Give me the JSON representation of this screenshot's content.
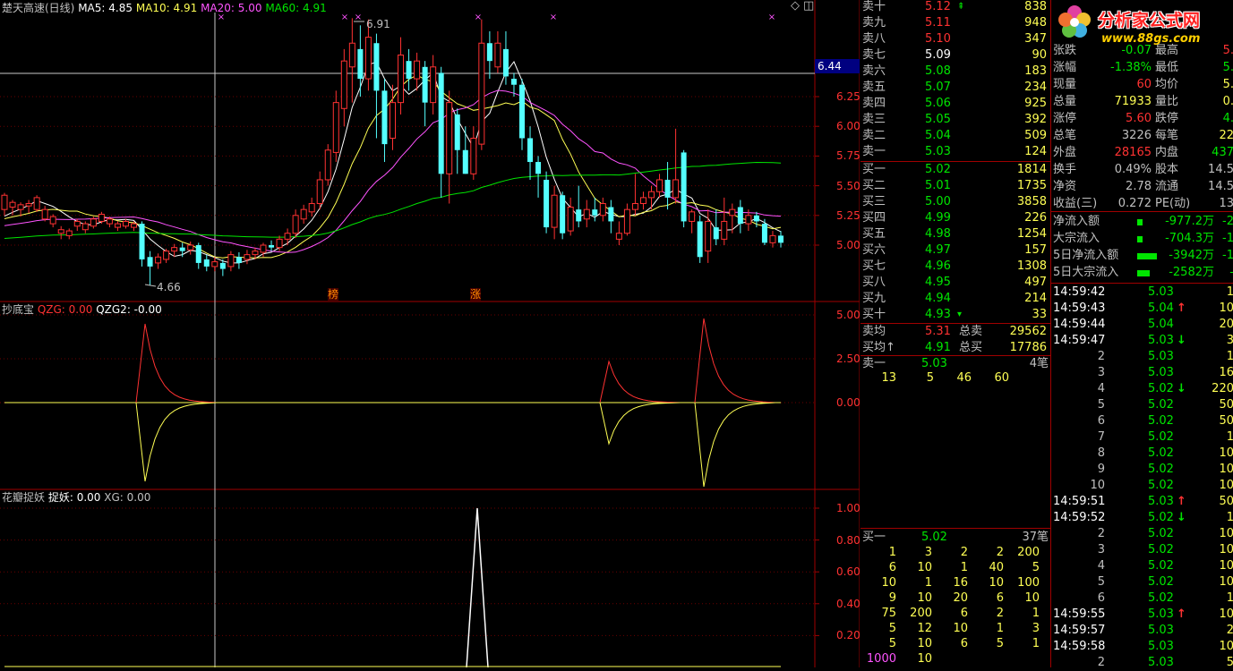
{
  "header": {
    "stock_name": "楚天高速(日线)",
    "ma5": "MA5: 4.85",
    "ma10": "MA10: 4.91",
    "ma20": "MA20: 5.00",
    "ma60": "MA60: 4.91",
    "high_label": "6.91",
    "low_label": "4.66",
    "cursor_price": "6.44",
    "mark_1": "榜",
    "mark_2": "涨"
  },
  "price_axis": [
    "6.25",
    "6.00",
    "5.75",
    "5.50",
    "5.25",
    "5.00"
  ],
  "indicator1": {
    "title": "抄底宝",
    "qzg": "QZG: 0.00",
    "qzg2": "QZG2: -0.00",
    "axis": [
      "5.00",
      "2.50",
      "0.00"
    ]
  },
  "indicator2": {
    "title": "花瓣捉妖",
    "zy": "捉妖: 0.00",
    "xg": "XG: 0.00",
    "axis": [
      "1.00",
      "0.80",
      "0.60",
      "0.40",
      "0.20"
    ]
  },
  "candles": [
    [
      5.3,
      5.42,
      5.25,
      5.44,
      0
    ],
    [
      5.32,
      5.36,
      5.25,
      5.38,
      0
    ],
    [
      5.3,
      5.34,
      5.24,
      5.36,
      0
    ],
    [
      5.33,
      5.35,
      5.27,
      5.38,
      0
    ],
    [
      5.3,
      5.4,
      5.28,
      5.42,
      0
    ],
    [
      5.22,
      5.3,
      5.2,
      5.33,
      0
    ],
    [
      5.18,
      5.24,
      5.15,
      5.26,
      0
    ],
    [
      5.1,
      5.13,
      5.05,
      5.16,
      0
    ],
    [
      5.08,
      5.12,
      5.05,
      5.14,
      0
    ],
    [
      5.16,
      5.2,
      5.12,
      5.22,
      0
    ],
    [
      5.13,
      5.18,
      5.1,
      5.2,
      0
    ],
    [
      5.16,
      5.22,
      5.14,
      5.24,
      0
    ],
    [
      5.2,
      5.26,
      5.18,
      5.28,
      0
    ],
    [
      5.18,
      5.22,
      5.15,
      5.24,
      0
    ],
    [
      5.15,
      5.18,
      5.12,
      5.2,
      0
    ],
    [
      5.16,
      5.2,
      5.14,
      5.22,
      0
    ],
    [
      5.15,
      5.18,
      5.12,
      5.2,
      0
    ],
    [
      5.18,
      4.88,
      4.82,
      5.2,
      0
    ],
    [
      4.9,
      4.82,
      4.66,
      4.95,
      0
    ],
    [
      4.85,
      4.9,
      4.8,
      4.93,
      0
    ],
    [
      4.88,
      4.95,
      4.85,
      4.97,
      0
    ],
    [
      4.95,
      4.98,
      4.9,
      5.01,
      0
    ],
    [
      4.98,
      4.95,
      4.9,
      5.02,
      0
    ],
    [
      4.96,
      5.0,
      4.92,
      5.03,
      0
    ],
    [
      5.0,
      4.85,
      4.8,
      5.02,
      0
    ],
    [
      4.88,
      4.82,
      4.78,
      4.92,
      0
    ],
    [
      4.82,
      4.86,
      4.78,
      4.9,
      0
    ],
    [
      4.85,
      4.8,
      4.74,
      4.88,
      0
    ],
    [
      4.82,
      4.92,
      4.78,
      4.95,
      0
    ],
    [
      4.9,
      4.85,
      4.8,
      4.94,
      0
    ],
    [
      4.88,
      4.92,
      4.84,
      4.96,
      0
    ],
    [
      4.92,
      4.95,
      4.88,
      4.98,
      0
    ],
    [
      4.94,
      5.0,
      4.9,
      5.02,
      0
    ],
    [
      5.0,
      4.98,
      4.95,
      5.04,
      0
    ],
    [
      4.98,
      5.05,
      4.95,
      5.08,
      0
    ],
    [
      5.05,
      5.1,
      5.0,
      5.14,
      0
    ],
    [
      5.1,
      5.25,
      5.06,
      5.3,
      0
    ],
    [
      5.22,
      5.3,
      5.18,
      5.34,
      0
    ],
    [
      5.28,
      5.35,
      5.24,
      5.4,
      0
    ],
    [
      5.35,
      5.55,
      5.3,
      5.62,
      0
    ],
    [
      5.55,
      5.8,
      5.5,
      5.85,
      0
    ],
    [
      5.78,
      6.2,
      5.7,
      6.3,
      0
    ],
    [
      6.15,
      6.55,
      6.0,
      6.65,
      0
    ],
    [
      6.5,
      6.7,
      6.2,
      6.91,
      0
    ],
    [
      6.65,
      6.4,
      6.25,
      6.85,
      0
    ],
    [
      6.4,
      6.75,
      6.3,
      6.9,
      0
    ],
    [
      6.7,
      6.3,
      5.9,
      6.78,
      0
    ],
    [
      6.3,
      5.85,
      5.7,
      6.4,
      0
    ],
    [
      5.9,
      6.2,
      5.8,
      6.35,
      0
    ],
    [
      6.2,
      6.6,
      6.1,
      6.75,
      0
    ],
    [
      6.55,
      6.4,
      6.3,
      6.65,
      0
    ],
    [
      6.4,
      6.55,
      6.3,
      6.62,
      0
    ],
    [
      6.5,
      6.2,
      6.0,
      6.55,
      0
    ],
    [
      6.2,
      6.5,
      6.1,
      6.6,
      0
    ],
    [
      6.45,
      5.6,
      5.4,
      6.5,
      0
    ],
    [
      5.6,
      6.2,
      5.35,
      6.3,
      0
    ],
    [
      6.1,
      5.8,
      5.6,
      6.15,
      0
    ],
    [
      5.8,
      5.6,
      5.6,
      6.0,
      0
    ],
    [
      5.6,
      5.9,
      5.55,
      6.0,
      0
    ],
    [
      5.85,
      6.7,
      5.8,
      6.9,
      0
    ],
    [
      6.7,
      6.55,
      6.4,
      6.8,
      0
    ],
    [
      6.5,
      6.7,
      6.45,
      6.8,
      0
    ],
    [
      6.65,
      6.42,
      6.35,
      6.8,
      0
    ],
    [
      6.4,
      6.35,
      6.25,
      6.45,
      0
    ],
    [
      6.35,
      5.9,
      5.8,
      6.4,
      0
    ],
    [
      5.9,
      5.7,
      5.55,
      6.0,
      0
    ],
    [
      5.7,
      5.6,
      5.4,
      5.75,
      0
    ],
    [
      5.55,
      5.15,
      5.1,
      5.62,
      0
    ],
    [
      5.15,
      5.42,
      5.05,
      5.5,
      0
    ],
    [
      5.42,
      5.1,
      5.05,
      5.45,
      0
    ],
    [
      5.12,
      5.32,
      5.08,
      5.4,
      0
    ],
    [
      5.3,
      5.2,
      5.15,
      5.5,
      0
    ],
    [
      5.22,
      5.3,
      5.15,
      5.38,
      0
    ],
    [
      5.3,
      5.25,
      5.2,
      5.4,
      0
    ],
    [
      5.25,
      5.35,
      5.2,
      5.4,
      0
    ],
    [
      5.32,
      5.2,
      5.1,
      5.38,
      0
    ],
    [
      5.05,
      5.1,
      5.0,
      5.2,
      0
    ],
    [
      5.1,
      5.3,
      5.08,
      5.35,
      0
    ],
    [
      5.3,
      5.35,
      5.25,
      5.6,
      0
    ],
    [
      5.35,
      5.4,
      5.3,
      5.45,
      0
    ],
    [
      5.4,
      5.45,
      5.3,
      5.5,
      0
    ],
    [
      5.45,
      5.55,
      5.4,
      5.6,
      0
    ],
    [
      5.55,
      5.4,
      5.3,
      5.7,
      0
    ],
    [
      5.4,
      5.55,
      5.35,
      5.98,
      0
    ],
    [
      5.78,
      5.2,
      5.15,
      5.8,
      0
    ],
    [
      5.2,
      5.28,
      5.1,
      5.3,
      0
    ],
    [
      5.2,
      4.9,
      4.85,
      5.25,
      0
    ],
    [
      4.95,
      5.2,
      4.85,
      5.3,
      0
    ],
    [
      5.15,
      5.05,
      5.0,
      5.3,
      0
    ],
    [
      5.05,
      5.2,
      5.0,
      5.4,
      0
    ],
    [
      5.25,
      5.3,
      5.1,
      5.35,
      0
    ],
    [
      5.32,
      5.18,
      5.1,
      5.38,
      0
    ],
    [
      5.18,
      5.25,
      5.12,
      5.3,
      0
    ],
    [
      5.25,
      5.2,
      5.15,
      5.28,
      0
    ],
    [
      5.18,
      5.02,
      5.0,
      5.22,
      0
    ],
    [
      5.02,
      5.08,
      4.98,
      5.12,
      0
    ],
    [
      5.08,
      5.02,
      4.98,
      5.12,
      0
    ]
  ],
  "quote": {
    "sell": [
      {
        "label": "卖十",
        "price": "5.12",
        "arrow": "⇞",
        "vol": "838",
        "color": "red"
      },
      {
        "label": "卖九",
        "price": "5.11",
        "arrow": "",
        "vol": "948",
        "color": "red"
      },
      {
        "label": "卖八",
        "price": "5.10",
        "arrow": "",
        "vol": "347",
        "color": "red"
      },
      {
        "label": "卖七",
        "price": "5.09",
        "arrow": "",
        "vol": "90",
        "color": "wht"
      },
      {
        "label": "卖六",
        "price": "5.08",
        "arrow": "",
        "vol": "183",
        "color": "grn"
      },
      {
        "label": "卖五",
        "price": "5.07",
        "arrow": "",
        "vol": "234",
        "color": "grn"
      },
      {
        "label": "卖四",
        "price": "5.06",
        "arrow": "",
        "vol": "925",
        "color": "grn"
      },
      {
        "label": "卖三",
        "price": "5.05",
        "arrow": "",
        "vol": "392",
        "color": "grn"
      },
      {
        "label": "卖二",
        "price": "5.04",
        "arrow": "",
        "vol": "509",
        "color": "grn"
      },
      {
        "label": "卖一",
        "price": "5.03",
        "arrow": "",
        "vol": "124",
        "color": "grn"
      }
    ],
    "buy": [
      {
        "label": "买一",
        "price": "5.02",
        "arrow": "",
        "vol": "1814",
        "color": "grn"
      },
      {
        "label": "买二",
        "price": "5.01",
        "arrow": "",
        "vol": "1735",
        "color": "grn"
      },
      {
        "label": "买三",
        "price": "5.00",
        "arrow": "",
        "vol": "3858",
        "color": "grn"
      },
      {
        "label": "买四",
        "price": "4.99",
        "arrow": "",
        "vol": "226",
        "color": "grn"
      },
      {
        "label": "买五",
        "price": "4.98",
        "arrow": "",
        "vol": "1254",
        "color": "grn"
      },
      {
        "label": "买六",
        "price": "4.97",
        "arrow": "",
        "vol": "157",
        "color": "grn"
      },
      {
        "label": "买七",
        "price": "4.96",
        "arrow": "",
        "vol": "1308",
        "color": "grn"
      },
      {
        "label": "买八",
        "price": "4.95",
        "arrow": "",
        "vol": "497",
        "color": "grn"
      },
      {
        "label": "买九",
        "price": "4.94",
        "arrow": "",
        "vol": "214",
        "color": "grn"
      },
      {
        "label": "买十",
        "price": "4.93",
        "arrow": "▾",
        "vol": "33",
        "color": "grn"
      }
    ],
    "avg": [
      {
        "label": "卖均",
        "price": "5.31",
        "pcolor": "red",
        "label2": "总卖",
        "val": "29562"
      },
      {
        "label": "买均↑",
        "price": "4.91",
        "pcolor": "grn",
        "label2": "总买",
        "val": "17786"
      }
    ],
    "sell1_queue": {
      "label": "卖一",
      "price": "5.03",
      "count": "4笔",
      "orders": [
        "13",
        "5",
        "46",
        "60"
      ]
    },
    "buy1_queue": {
      "label": "买一",
      "price": "5.02",
      "count": "37笔",
      "orders": [
        [
          "1",
          "3",
          "2",
          "2",
          "200"
        ],
        [
          "6",
          "10",
          "1",
          "40",
          "5"
        ],
        [
          "10",
          "1",
          "16",
          "10",
          "100"
        ],
        [
          "9",
          "10",
          "20",
          "6",
          "10"
        ],
        [
          "75",
          "200",
          "6",
          "2",
          "1"
        ],
        [
          "5",
          "12",
          "10",
          "1",
          "3"
        ],
        [
          "5",
          "10",
          "6",
          "5",
          "1"
        ],
        [
          "1000",
          "10",
          "",
          "",
          ""
        ]
      ]
    }
  },
  "stats": [
    {
      "l1": "张跌",
      "v1": "-0.07",
      "c1": "grn",
      "l2": "最高",
      "v2": "5.",
      "c2": "red"
    },
    {
      "l1": "涨幅",
      "v1": "-1.38%",
      "c1": "grn",
      "l2": "最低",
      "v2": "5.",
      "c2": "grn"
    },
    {
      "l1": "现量",
      "v1": "60",
      "c1": "red",
      "l2": "均价",
      "v2": "5.",
      "c2": "yel"
    },
    {
      "l1": "总量",
      "v1": "71933",
      "c1": "yel",
      "l2": "量比",
      "v2": "0.",
      "c2": "yel"
    },
    {
      "l1": "涨停",
      "v1": "5.60",
      "c1": "red",
      "l2": "跌停",
      "v2": "4.",
      "c2": "grn"
    },
    {
      "l1": "总笔",
      "v1": "3226",
      "c1": "gry",
      "l2": "每笔",
      "v2": "22",
      "c2": "yel"
    },
    {
      "l1": "外盘",
      "v1": "28165",
      "c1": "red",
      "l2": "内盘",
      "v2": "437",
      "c2": "grn"
    },
    {
      "l1": "换手",
      "v1": "0.49%",
      "c1": "gry",
      "l2": "股本",
      "v2": "14.5",
      "c2": "gry"
    },
    {
      "l1": "净资",
      "v1": "2.78",
      "c1": "gry",
      "l2": "流通",
      "v2": "14.5",
      "c2": "gry"
    },
    {
      "l1": "收益(三)",
      "v1": "0.272",
      "c1": "gry",
      "l2": "PE(动)",
      "v2": "13",
      "c2": "gry"
    }
  ],
  "flows": [
    {
      "label": "净流入额",
      "bar": "▮",
      "val": "-977.2万",
      "val2": "-2",
      "bar_w": 6
    },
    {
      "label": "大宗流入",
      "bar": "▮",
      "val": "-704.3万",
      "val2": "-1",
      "bar_w": 6
    },
    {
      "label": "5日净流入额",
      "bar": "▮",
      "val": "-3942万",
      "val2": "-1",
      "bar_w": 22
    },
    {
      "label": "5日大宗流入",
      "bar": "▮",
      "val": "-2582万",
      "val2": "-",
      "bar_w": 14
    }
  ],
  "ticks": [
    {
      "t": "14:59:42",
      "p": "5.03",
      "a": "",
      "v": "1"
    },
    {
      "t": "14:59:43",
      "p": "5.04",
      "a": "↑",
      "v": "10"
    },
    {
      "t": "14:59:44",
      "p": "5.04",
      "a": "",
      "v": "20"
    },
    {
      "t": "14:59:47",
      "p": "5.03",
      "a": "↓",
      "v": "3"
    },
    {
      "t": "2",
      "p": "5.03",
      "a": "",
      "v": "1"
    },
    {
      "t": "3",
      "p": "5.03",
      "a": "",
      "v": "16"
    },
    {
      "t": "4",
      "p": "5.02",
      "a": "↓",
      "v": "220"
    },
    {
      "t": "5",
      "p": "5.02",
      "a": "",
      "v": "50"
    },
    {
      "t": "6",
      "p": "5.02",
      "a": "",
      "v": "50"
    },
    {
      "t": "7",
      "p": "5.02",
      "a": "",
      "v": "1"
    },
    {
      "t": "8",
      "p": "5.02",
      "a": "",
      "v": "10"
    },
    {
      "t": "9",
      "p": "5.02",
      "a": "",
      "v": "10"
    },
    {
      "t": "10",
      "p": "5.02",
      "a": "",
      "v": "10"
    },
    {
      "t": "14:59:51",
      "p": "5.03",
      "a": "↑",
      "v": "50"
    },
    {
      "t": "14:59:52",
      "p": "5.02",
      "a": "↓",
      "v": "1"
    },
    {
      "t": "2",
      "p": "5.02",
      "a": "",
      "v": "10"
    },
    {
      "t": "3",
      "p": "5.02",
      "a": "",
      "v": "10"
    },
    {
      "t": "4",
      "p": "5.02",
      "a": "",
      "v": "10"
    },
    {
      "t": "5",
      "p": "5.02",
      "a": "",
      "v": "10"
    },
    {
      "t": "6",
      "p": "5.02",
      "a": "",
      "v": "1"
    },
    {
      "t": "14:59:55",
      "p": "5.03",
      "a": "↑",
      "v": "10"
    },
    {
      "t": "14:59:57",
      "p": "5.03",
      "a": "",
      "v": "2"
    },
    {
      "t": "14:59:58",
      "p": "5.03",
      "a": "",
      "v": "10"
    },
    {
      "t": "2",
      "p": "5.03",
      "a": "",
      "v": "5"
    }
  ],
  "logo": {
    "text": "分析家公式网",
    "url": "www.88gs.com"
  }
}
